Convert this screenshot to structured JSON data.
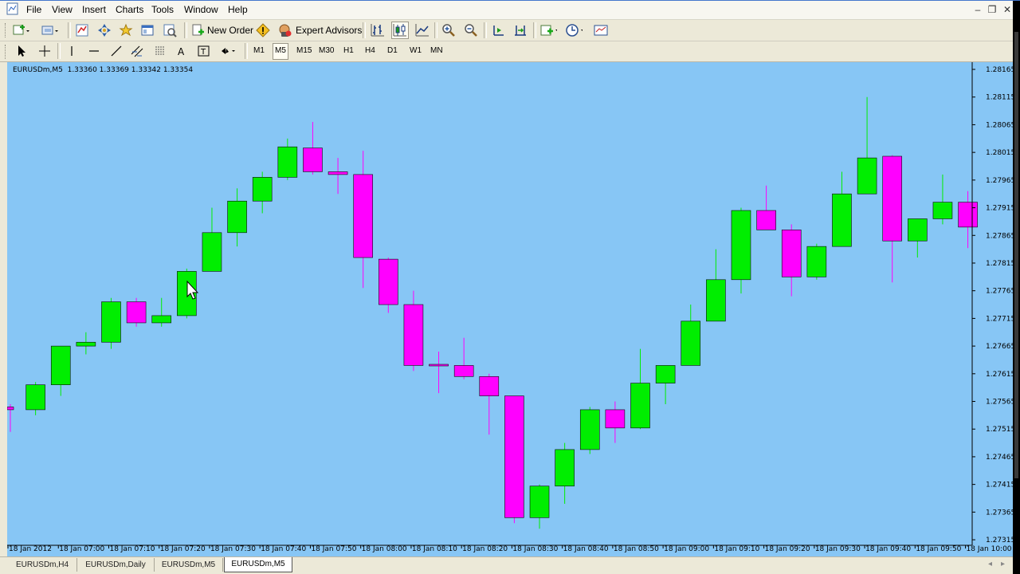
{
  "menu": {
    "items": [
      "File",
      "View",
      "Insert",
      "Charts",
      "Tools",
      "Window",
      "Help"
    ],
    "window_controls": [
      "–",
      "❐",
      "✕"
    ]
  },
  "toolbar": {
    "new_order_label": "New Order",
    "expert_advisors_label": "Expert Advisors",
    "timeframes": [
      "M1",
      "M5",
      "M15",
      "M30",
      "H1",
      "H4",
      "D1",
      "W1",
      "MN"
    ],
    "active_timeframe": "M5"
  },
  "chart": {
    "info": "EURUSDm,M5  1.33360 1.33369 1.33342 1.33354",
    "background": "#87c6f5",
    "bull_color": "#00ee00",
    "bear_color": "#ff00ff"
  },
  "tabs": {
    "items": [
      "EURUSDm,H4",
      "EURUSDm,Daily",
      "EURUSDm,M5",
      "EURUSDm,M5"
    ],
    "active_index": 3
  },
  "chart_data": {
    "type": "candlestick",
    "symbol": "EURUSDm",
    "timeframe": "M5",
    "y_ticks": [
      "1.28165",
      "1.28115",
      "1.28065",
      "1.28015",
      "1.27965",
      "1.27915",
      "1.27865",
      "1.27815",
      "1.27765",
      "1.27715",
      "1.27665",
      "1.27615",
      "1.27565",
      "1.27515",
      "1.27465",
      "1.27415",
      "1.27365",
      "1.27315"
    ],
    "x_ticks": [
      "18 Jan 2012",
      "18 Jan 07:00",
      "18 Jan 07:10",
      "18 Jan 07:20",
      "18 Jan 07:30",
      "18 Jan 07:40",
      "18 Jan 07:50",
      "18 Jan 08:00",
      "18 Jan 08:10",
      "18 Jan 08:20",
      "18 Jan 08:30",
      "18 Jan 08:40",
      "18 Jan 08:50",
      "18 Jan 09:00",
      "18 Jan 09:10",
      "18 Jan 09:20",
      "18 Jan 09:30",
      "18 Jan 09:40",
      "18 Jan 09:50",
      "18 Jan 10:00"
    ],
    "ylim": [
      1.27305,
      1.28178
    ],
    "candles": [
      {
        "o": 1.27555,
        "h": 1.2756,
        "l": 1.2751,
        "c": 1.2755
      },
      {
        "o": 1.2755,
        "h": 1.276,
        "l": 1.2754,
        "c": 1.27595
      },
      {
        "o": 1.27595,
        "h": 1.27665,
        "l": 1.27575,
        "c": 1.27665
      },
      {
        "o": 1.27665,
        "h": 1.2769,
        "l": 1.2765,
        "c": 1.27672
      },
      {
        "o": 1.27672,
        "h": 1.27752,
        "l": 1.2766,
        "c": 1.27745
      },
      {
        "o": 1.27745,
        "h": 1.27752,
        "l": 1.277,
        "c": 1.27707
      },
      {
        "o": 1.27707,
        "h": 1.27752,
        "l": 1.277,
        "c": 1.2772
      },
      {
        "o": 1.2772,
        "h": 1.27805,
        "l": 1.27715,
        "c": 1.278
      },
      {
        "o": 1.278,
        "h": 1.27915,
        "l": 1.278,
        "c": 1.2787
      },
      {
        "o": 1.2787,
        "h": 1.2795,
        "l": 1.27845,
        "c": 1.27927
      },
      {
        "o": 1.27927,
        "h": 1.2798,
        "l": 1.27905,
        "c": 1.2797
      },
      {
        "o": 1.2797,
        "h": 1.2804,
        "l": 1.27965,
        "c": 1.28025
      },
      {
        "o": 1.28023,
        "h": 1.2807,
        "l": 1.27975,
        "c": 1.2798
      },
      {
        "o": 1.2798,
        "h": 1.28005,
        "l": 1.2794,
        "c": 1.27975
      },
      {
        "o": 1.27975,
        "h": 1.28018,
        "l": 1.2777,
        "c": 1.27825
      },
      {
        "o": 1.27822,
        "h": 1.27825,
        "l": 1.27725,
        "c": 1.2774
      },
      {
        "o": 1.2774,
        "h": 1.27765,
        "l": 1.2762,
        "c": 1.2763
      },
      {
        "o": 1.27632,
        "h": 1.27655,
        "l": 1.2758,
        "c": 1.2763
      },
      {
        "o": 1.2763,
        "h": 1.2768,
        "l": 1.27605,
        "c": 1.2761
      },
      {
        "o": 1.2761,
        "h": 1.27615,
        "l": 1.27505,
        "c": 1.27575
      },
      {
        "o": 1.27575,
        "h": 1.27575,
        "l": 1.27345,
        "c": 1.27355
      },
      {
        "o": 1.27355,
        "h": 1.27415,
        "l": 1.27335,
        "c": 1.27412
      },
      {
        "o": 1.27412,
        "h": 1.2749,
        "l": 1.2738,
        "c": 1.27478
      },
      {
        "o": 1.27478,
        "h": 1.27555,
        "l": 1.2747,
        "c": 1.2755
      },
      {
        "o": 1.2755,
        "h": 1.27565,
        "l": 1.2749,
        "c": 1.27517
      },
      {
        "o": 1.27517,
        "h": 1.2766,
        "l": 1.27515,
        "c": 1.27598
      },
      {
        "o": 1.27598,
        "h": 1.27628,
        "l": 1.2756,
        "c": 1.2763
      },
      {
        "o": 1.2763,
        "h": 1.2774,
        "l": 1.2763,
        "c": 1.2771
      },
      {
        "o": 1.2771,
        "h": 1.2784,
        "l": 1.2771,
        "c": 1.27785
      },
      {
        "o": 1.27785,
        "h": 1.27915,
        "l": 1.2776,
        "c": 1.2791
      },
      {
        "o": 1.2791,
        "h": 1.27955,
        "l": 1.2788,
        "c": 1.27875
      },
      {
        "o": 1.27875,
        "h": 1.27885,
        "l": 1.27755,
        "c": 1.2779
      },
      {
        "o": 1.2779,
        "h": 1.2785,
        "l": 1.27785,
        "c": 1.27845
      },
      {
        "o": 1.27845,
        "h": 1.2798,
        "l": 1.27845,
        "c": 1.2794
      },
      {
        "o": 1.2794,
        "h": 1.28115,
        "l": 1.2794,
        "c": 1.28005
      },
      {
        "o": 1.28008,
        "h": 1.2801,
        "l": 1.2778,
        "c": 1.27855
      },
      {
        "o": 1.27855,
        "h": 1.27895,
        "l": 1.27825,
        "c": 1.27895
      },
      {
        "o": 1.27895,
        "h": 1.27975,
        "l": 1.27885,
        "c": 1.27925
      },
      {
        "o": 1.27925,
        "h": 1.27945,
        "l": 1.27842,
        "c": 1.2788
      }
    ]
  }
}
